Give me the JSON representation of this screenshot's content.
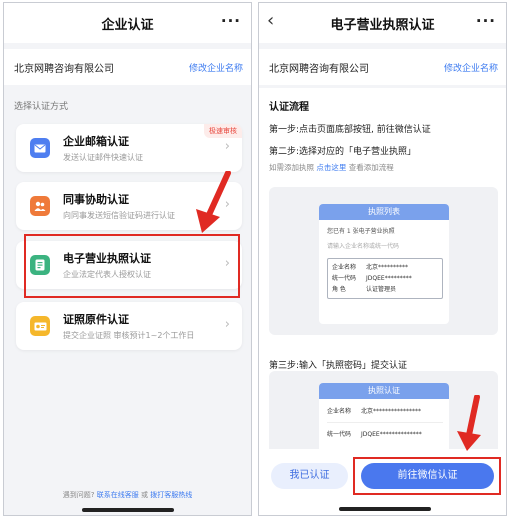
{
  "left": {
    "nav_title": "企业认证",
    "more": "···",
    "company_name": "北京网聘咨询有限公司",
    "edit_link": "修改企业名称",
    "section_label": "选择认证方式",
    "methods": [
      {
        "title": "企业邮箱认证",
        "sub": "发送认证邮件快速认证",
        "tag": "极速审核",
        "icon": "mail-icon",
        "color": "#4e7ef0"
      },
      {
        "title": "同事协助认证",
        "sub": "向同事发送短信验证码进行认证",
        "tag": "",
        "icon": "people-icon",
        "color": "#ef7a3a"
      },
      {
        "title": "电子营业执照认证",
        "sub": "企业法定代表人授权认证",
        "tag": "",
        "icon": "license-icon",
        "color": "#3bb380"
      },
      {
        "title": "证照原件认证",
        "sub": "提交企业证照 审核预计1~2个工作日",
        "tag": "",
        "icon": "id-card-icon",
        "color": "#f5b72b"
      }
    ],
    "help_prefix": "遇到问题?",
    "help_link1": "联系在线客服",
    "help_or": "或",
    "help_link2": "拨打客服热线"
  },
  "right": {
    "nav_title": "电子营业执照认证",
    "more": "···",
    "company_name": "北京网聘咨询有限公司",
    "edit_link": "修改企业名称",
    "flow_title": "认证流程",
    "step1": "第一步:点击页面底部按钮, 前往微信认证",
    "step2": "第二步:选择对应的「电子营业执照」",
    "step2_link1": "如需添加执照",
    "step2_link2": "点击这里",
    "step2_link3": "查看添加流程",
    "mock1": {
      "header": "执照列表",
      "line1": "您已有 1 张电子营业执照",
      "line2": "请输入企业名称或统一代码",
      "rows": [
        {
          "label": "企业名称",
          "value": "北京**********"
        },
        {
          "label": "统一代码",
          "value": "JDQEE*********"
        },
        {
          "label": "角    色",
          "value": "认证管理员"
        }
      ]
    },
    "step3": "第三步:输入「执照密码」提交认证",
    "mock2": {
      "header": "执照认证",
      "rows": [
        {
          "label": "企业名称",
          "value": "北京****************"
        },
        {
          "label": "统一代码",
          "value": "JDQEE**************"
        }
      ]
    },
    "btn_done": "我已认证",
    "btn_go": "前往微信认证"
  },
  "colors": {
    "accent": "#3d7bf0",
    "highlight": "#e02a23",
    "primary_button": "#4a78ee"
  }
}
